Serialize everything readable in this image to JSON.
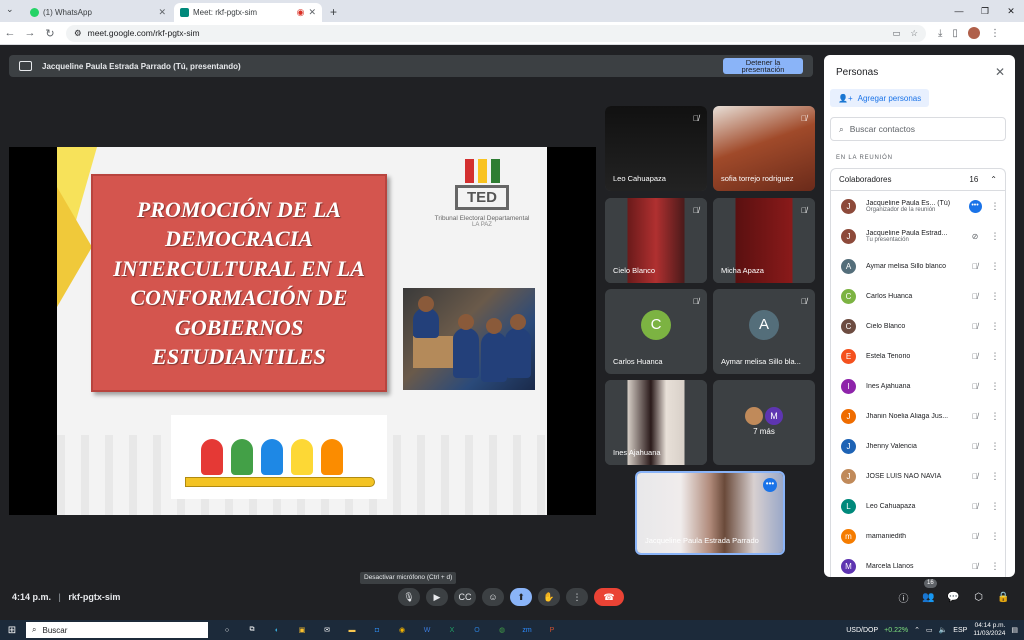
{
  "browser": {
    "tabs": [
      {
        "label": "(1) WhatsApp",
        "color": "#25d366"
      },
      {
        "label": "Meet: rkf-pgtx-sim",
        "color": "#00897b"
      }
    ],
    "url": "meet.google.com/rkf-pgtx-sim"
  },
  "presentation": {
    "presenter_label": "Jacqueline Paula Estrada Parrado (Tú, presentando)",
    "stop_button": "Detener la presentación"
  },
  "slide": {
    "title": "PROMOCIÓN DE LA DEMOCRACIA INTERCULTURAL EN LA CONFORMACIÓN DE GOBIERNOS ESTUDIANTILES",
    "logo_text": "TED",
    "logo_sub": "Tribunal Electoral Departamental",
    "logo_sub2": "LA PAZ"
  },
  "tiles": [
    {
      "name": "Leo Cahuapaza"
    },
    {
      "name": "sofia torrejo rodriguez"
    },
    {
      "name": "Cielo Blanco"
    },
    {
      "name": "Micha Apaza"
    },
    {
      "name": "Carlos Huanca",
      "initial": "C",
      "color": "#7cb342"
    },
    {
      "name": "Aymar melisa Sillo bla...",
      "initial": "A",
      "color": "#546e7a"
    },
    {
      "name": "Ines Ajahuana"
    },
    {
      "name": "7 más",
      "initial": "M"
    },
    {
      "name": "Jacqueline Paula Estrada Parrado"
    }
  ],
  "panel": {
    "title": "Personas",
    "add_button": "Agregar personas",
    "search_placeholder": "Buscar contactos",
    "section": "EN LA REUNIÓN",
    "group_label": "Colaboradores",
    "group_count": "16",
    "people": [
      {
        "name": "Jacqueline Paula Es... (Tú)",
        "sub": "Organizador de la reunión",
        "initial": "J",
        "color": "#8d4a3a"
      },
      {
        "name": "Jacqueline Paula Estrad...",
        "sub": "Tu presentación",
        "initial": "J",
        "color": "#8d4a3a"
      },
      {
        "name": "Aymar melisa Sillo blanco",
        "sub": "",
        "initial": "A",
        "color": "#546e7a"
      },
      {
        "name": "Carlos Huanca",
        "sub": "",
        "initial": "C",
        "color": "#7cb342"
      },
      {
        "name": "Cielo Blanco",
        "sub": "",
        "initial": "C",
        "color": "#6d4c41"
      },
      {
        "name": "Estela Tenorio",
        "sub": "",
        "initial": "E",
        "color": "#f4511e"
      },
      {
        "name": "Ines Ajahuana",
        "sub": "",
        "initial": "I",
        "color": "#8e24aa"
      },
      {
        "name": "Jhanin Noelia Aliaga Jus...",
        "sub": "",
        "initial": "J",
        "color": "#ef6c00"
      },
      {
        "name": "Jhenny Valencia",
        "sub": "",
        "initial": "J",
        "color": "#1e63b5"
      },
      {
        "name": "JOSE LUIS NAO NAVIA",
        "sub": "",
        "initial": "J",
        "color": "#c08a5a"
      },
      {
        "name": "Leo Cahuapaza",
        "sub": "",
        "initial": "L",
        "color": "#00897b"
      },
      {
        "name": "mamaniedith",
        "sub": "",
        "initial": "m",
        "color": "#f57c00"
      },
      {
        "name": "Marcela Llanos",
        "sub": "",
        "initial": "M",
        "color": "#5e35b1"
      }
    ]
  },
  "bottom": {
    "tooltip": "Desactivar micrófono (Ctrl + d)",
    "time": "4:14 p.m.",
    "separator": "|",
    "code": "rkf-pgtx-sim",
    "people_badge": "16"
  },
  "taskbar": {
    "search": "Buscar",
    "ticker": "USD/DOP",
    "ticker_change": "+0.22%",
    "lang": "ESP",
    "time": "04:14 p.m.",
    "date": "11/03/2024"
  }
}
